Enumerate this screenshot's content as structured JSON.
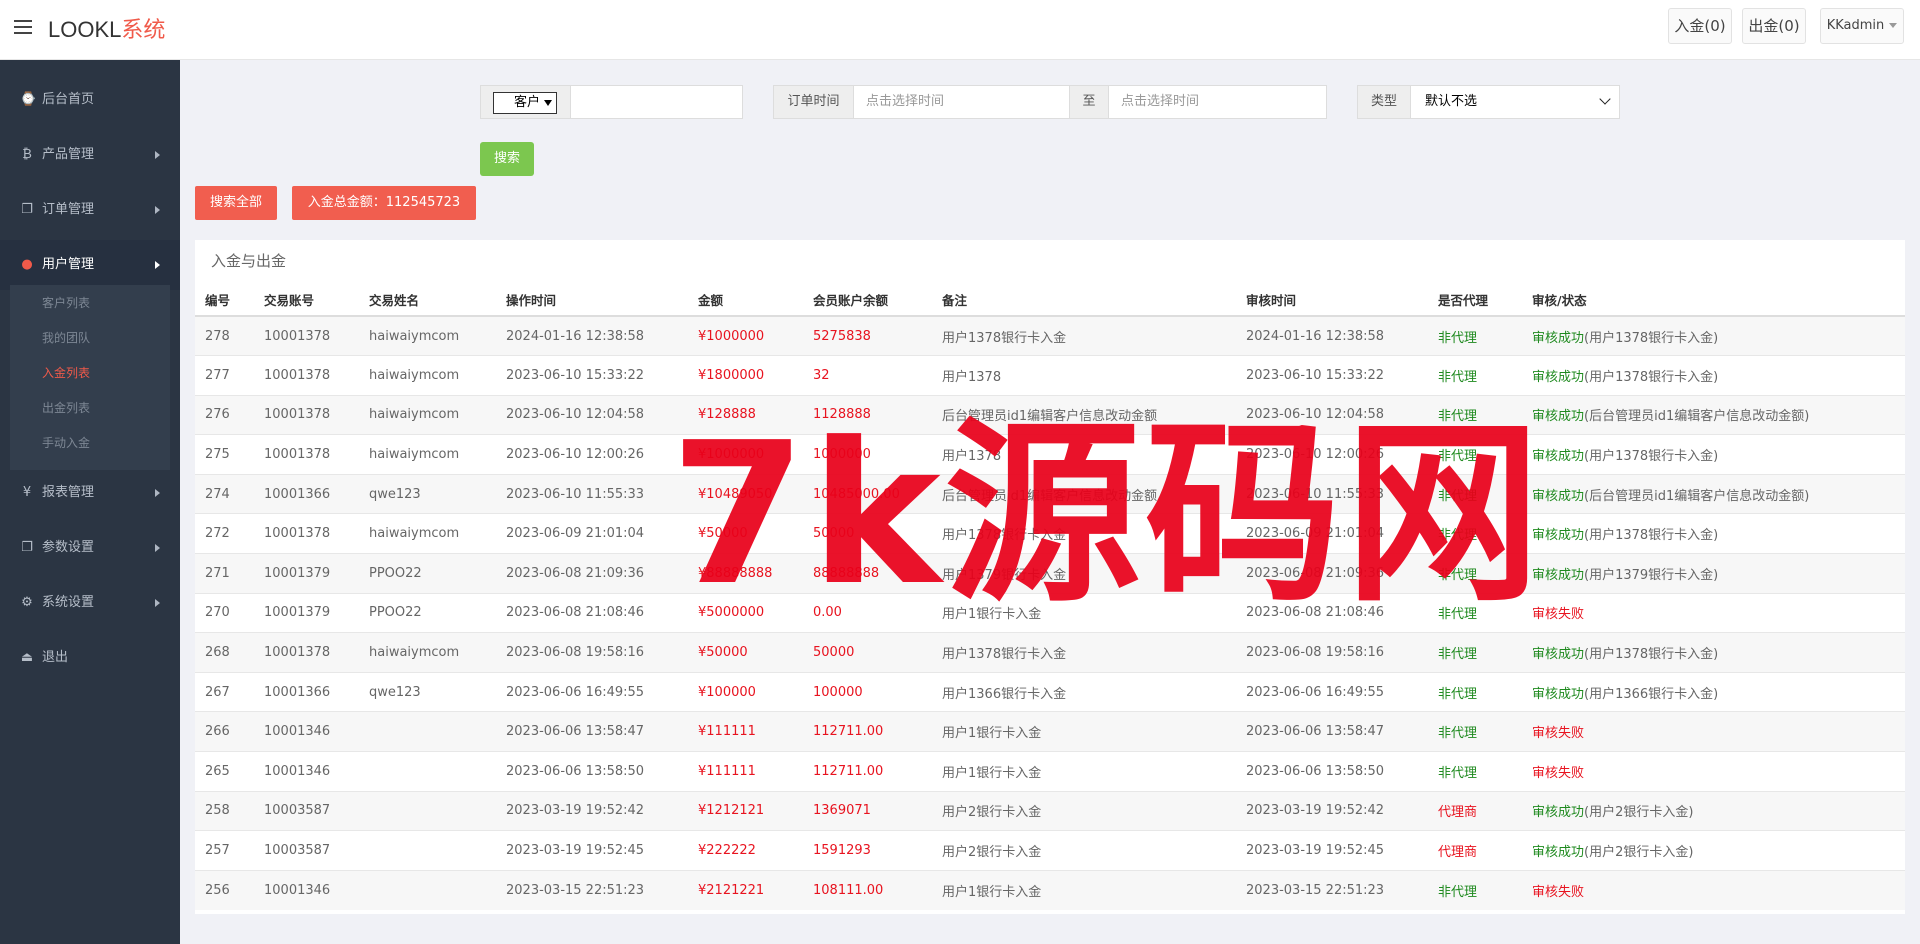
{
  "header": {
    "logo_main": "LOOKL",
    "logo_accent": "系统",
    "deposit_btn": "入金(0)",
    "withdraw_btn": "出金(0)",
    "user": "KKadmin"
  },
  "sidebar": {
    "items": [
      {
        "icon": "⌚",
        "label": "后台首页"
      },
      {
        "icon": "₿",
        "label": "产品管理"
      },
      {
        "icon": "❐",
        "label": "订单管理"
      },
      {
        "icon": "●",
        "label": "用户管理"
      },
      {
        "icon": "¥",
        "label": "报表管理"
      },
      {
        "icon": "❐",
        "label": "参数设置"
      },
      {
        "icon": "⚙",
        "label": "系统设置"
      },
      {
        "icon": "⏏",
        "label": "退出"
      }
    ],
    "sub_items": [
      "客户列表",
      "我的团队",
      "入金列表",
      "出金列表",
      "手动入金"
    ]
  },
  "filters": {
    "customer_select": "客户",
    "customer_value": "",
    "order_time_label": "订单时间",
    "time_start_placeholder": "点击选择时间",
    "to_label": "至",
    "time_end_placeholder": "点击选择时间",
    "type_label": "类型",
    "type_value": "默认不选",
    "search_btn": "搜索",
    "search_all_btn": "搜索全部",
    "total_btn": "入金总金额：112545723"
  },
  "panel_title": "入金与出金",
  "table": {
    "headers": [
      "编号",
      "交易账号",
      "交易姓名",
      "操作时间",
      "金额",
      "会员账户余额",
      "备注",
      "审核时间",
      "是否代理",
      "审核/状态"
    ],
    "rows": [
      {
        "id": "278",
        "account": "10001378",
        "name": "haiwaiymcom",
        "op_time": "2024-01-16 12:38:58",
        "amount": "¥1000000",
        "balance": "5275838",
        "remark": "用户1378银行卡入金",
        "audit_time": "2024-01-16 12:38:58",
        "agent": "非代理",
        "status": "审核成功",
        "status_note": "(用户1378银行卡入金)"
      },
      {
        "id": "277",
        "account": "10001378",
        "name": "haiwaiymcom",
        "op_time": "2023-06-10 15:33:22",
        "amount": "¥1800000",
        "balance": "32",
        "remark": "用户1378",
        "audit_time": "2023-06-10 15:33:22",
        "agent": "非代理",
        "status": "审核成功",
        "status_note": "(用户1378银行卡入金)"
      },
      {
        "id": "276",
        "account": "10001378",
        "name": "haiwaiymcom",
        "op_time": "2023-06-10 12:04:58",
        "amount": "¥128888",
        "balance": "1128888",
        "remark": "后台管理员id1编辑客户信息改动金额",
        "audit_time": "2023-06-10 12:04:58",
        "agent": "非代理",
        "status": "审核成功",
        "status_note": "(后台管理员id1编辑客户信息改动金额)"
      },
      {
        "id": "275",
        "account": "10001378",
        "name": "haiwaiymcom",
        "op_time": "2023-06-10 12:00:26",
        "amount": "¥1000000",
        "balance": "1000000",
        "remark": "用户1378",
        "audit_time": "2023-06-10 12:00:26",
        "agent": "非代理",
        "status": "审核成功",
        "status_note": "(用户1378银行卡入金)"
      },
      {
        "id": "274",
        "account": "10001366",
        "name": "qwe123",
        "op_time": "2023-06-10 11:55:33",
        "amount": "¥10489050",
        "balance": "10485000.00",
        "remark": "后台管理员id1编辑客户信息改动金额",
        "audit_time": "2023-06-10 11:55:33",
        "agent": "非代理",
        "status": "审核成功",
        "status_note": "(后台管理员id1编辑客户信息改动金额)"
      },
      {
        "id": "272",
        "account": "10001378",
        "name": "haiwaiymcom",
        "op_time": "2023-06-09 21:01:04",
        "amount": "¥50000",
        "balance": "50000",
        "remark": "用户1378银行卡入金",
        "audit_time": "2023-06-09 21:01:04",
        "agent": "非代理",
        "status": "审核成功",
        "status_note": "(用户1378银行卡入金)"
      },
      {
        "id": "271",
        "account": "10001379",
        "name": "PPOO22",
        "op_time": "2023-06-08 21:09:36",
        "amount": "¥88888888",
        "balance": "88888888",
        "remark": "用户1379银行卡入金",
        "audit_time": "2023-06-08 21:09:36",
        "agent": "非代理",
        "status": "审核成功",
        "status_note": "(用户1379银行卡入金)"
      },
      {
        "id": "270",
        "account": "10001379",
        "name": "PPOO22",
        "op_time": "2023-06-08 21:08:46",
        "amount": "¥5000000",
        "balance": "0.00",
        "remark": "用户1银行卡入金",
        "audit_time": "2023-06-08 21:08:46",
        "agent": "非代理",
        "status": "审核失败",
        "status_note": ""
      },
      {
        "id": "268",
        "account": "10001378",
        "name": "haiwaiymcom",
        "op_time": "2023-06-08 19:58:16",
        "amount": "¥50000",
        "balance": "50000",
        "remark": "用户1378银行卡入金",
        "audit_time": "2023-06-08 19:58:16",
        "agent": "非代理",
        "status": "审核成功",
        "status_note": "(用户1378银行卡入金)"
      },
      {
        "id": "267",
        "account": "10001366",
        "name": "qwe123",
        "op_time": "2023-06-06 16:49:55",
        "amount": "¥100000",
        "balance": "100000",
        "remark": "用户1366银行卡入金",
        "audit_time": "2023-06-06 16:49:55",
        "agent": "非代理",
        "status": "审核成功",
        "status_note": "(用户1366银行卡入金)"
      },
      {
        "id": "266",
        "account": "10001346",
        "name": "",
        "op_time": "2023-06-06 13:58:47",
        "amount": "¥111111",
        "balance": "112711.00",
        "remark": "用户1银行卡入金",
        "audit_time": "2023-06-06 13:58:47",
        "agent": "非代理",
        "status": "审核失败",
        "status_note": ""
      },
      {
        "id": "265",
        "account": "10001346",
        "name": "",
        "op_time": "2023-06-06 13:58:50",
        "amount": "¥111111",
        "balance": "112711.00",
        "remark": "用户1银行卡入金",
        "audit_time": "2023-06-06 13:58:50",
        "agent": "非代理",
        "status": "审核失败",
        "status_note": ""
      },
      {
        "id": "258",
        "account": "10003587",
        "name": "",
        "op_time": "2023-03-19 19:52:42",
        "amount": "¥1212121",
        "balance": "1369071",
        "remark": "用户2银行卡入金",
        "audit_time": "2023-03-19 19:52:42",
        "agent": "代理商",
        "status": "审核成功",
        "status_note": "(用户2银行卡入金)"
      },
      {
        "id": "257",
        "account": "10003587",
        "name": "",
        "op_time": "2023-03-19 19:52:45",
        "amount": "¥222222",
        "balance": "1591293",
        "remark": "用户2银行卡入金",
        "audit_time": "2023-03-19 19:52:45",
        "agent": "代理商",
        "status": "审核成功",
        "status_note": "(用户2银行卡入金)"
      },
      {
        "id": "256",
        "account": "10001346",
        "name": "",
        "op_time": "2023-03-15 22:51:23",
        "amount": "¥2121221",
        "balance": "108111.00",
        "remark": "用户1银行卡入金",
        "audit_time": "2023-03-15 22:51:23",
        "agent": "非代理",
        "status": "审核失败",
        "status_note": ""
      }
    ]
  },
  "watermark": "7k源码网"
}
